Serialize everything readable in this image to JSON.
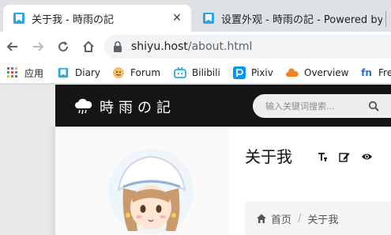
{
  "tabs": [
    {
      "title": "关于我 - 時雨の記",
      "active": true
    },
    {
      "title": "设置外观 - 時雨の記 - Powered by",
      "active": false
    }
  ],
  "toolbar": {
    "url_host": "shiyu.host",
    "url_path": "/about.html"
  },
  "bookmarks": [
    {
      "label": "应用",
      "icon": "apps-grid-icon"
    },
    {
      "label": "Diary",
      "icon": "bookmark-blue-icon"
    },
    {
      "label": "Forum",
      "icon": "forum-face-icon"
    },
    {
      "label": "Bilibili",
      "icon": "bilibili-icon"
    },
    {
      "label": "Pixiv",
      "icon": "pixiv-icon"
    },
    {
      "label": "Overview",
      "icon": "cloud-overview-icon"
    },
    {
      "label": "Fre",
      "icon": "fn-icon"
    }
  ],
  "site": {
    "name": "時雨の記",
    "search_placeholder": "输入关键词搜索...",
    "page_title": "关于我",
    "breadcrumb": {
      "home": "首页",
      "separator": "/",
      "current": "关于我"
    }
  },
  "colors": {
    "tab_strip": "#dee1e6",
    "site_header": "#151515",
    "bilibili": "#23ade5",
    "pixiv": "#0096fa",
    "overview": "#f48120",
    "fn": "#1a73e8"
  }
}
